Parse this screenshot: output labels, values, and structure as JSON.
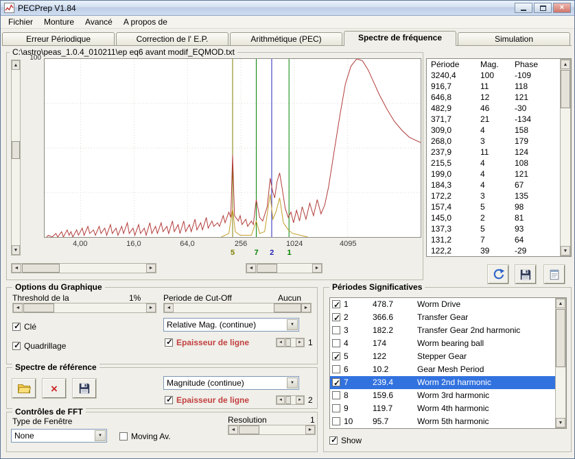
{
  "window": {
    "title": "PECPrep V1.84"
  },
  "menu": {
    "items": [
      "Fichier",
      "Monture",
      "Avancé",
      "A propos de"
    ]
  },
  "tabs": [
    {
      "label": "Erreur Périodique",
      "selected": false
    },
    {
      "label": "Correction de l' E.P.",
      "selected": false
    },
    {
      "label": "Arithmétique (PEC)",
      "selected": false
    },
    {
      "label": "Spectre de fréquence",
      "selected": true
    },
    {
      "label": "Simulation",
      "selected": false
    }
  ],
  "chart": {
    "group_title": "C:\\astro\\peas_1.0.4_010211\\ep eq6 avant modif_EQMOD.txt",
    "y_max_label": "100",
    "line_color": "#B03A37",
    "reference_color": "#C29B25",
    "grid_h": [
      0.25,
      0.5,
      0.75
    ],
    "x_ticks": [
      {
        "label": "4,00",
        "x": 0.096
      },
      {
        "label": "16,0",
        "x": 0.238
      },
      {
        "label": "64,0",
        "x": 0.38
      },
      {
        "label": "256",
        "x": 0.522
      },
      {
        "label": "1024",
        "x": 0.664
      },
      {
        "label": "4095",
        "x": 0.806
      }
    ],
    "markers": [
      {
        "label": "5",
        "x": 0.5,
        "color": "#7E7E00"
      },
      {
        "label": "7",
        "x": 0.563,
        "color": "#008000"
      },
      {
        "label": "2",
        "x": 0.604,
        "color": "#2222BB"
      },
      {
        "label": "1",
        "x": 0.65,
        "color": "#008000"
      }
    ],
    "spectrum_points": [
      [
        0.005,
        0
      ],
      [
        0.01,
        1
      ],
      [
        0.02,
        0
      ],
      [
        0.03,
        2
      ],
      [
        0.035,
        0
      ],
      [
        0.045,
        3
      ],
      [
        0.05,
        0
      ],
      [
        0.06,
        4
      ],
      [
        0.065,
        1
      ],
      [
        0.07,
        3
      ],
      [
        0.075,
        0
      ],
      [
        0.085,
        4
      ],
      [
        0.09,
        1
      ],
      [
        0.1,
        5
      ],
      [
        0.105,
        1
      ],
      [
        0.115,
        6
      ],
      [
        0.12,
        2
      ],
      [
        0.13,
        4
      ],
      [
        0.135,
        1
      ],
      [
        0.145,
        6
      ],
      [
        0.15,
        2
      ],
      [
        0.16,
        5
      ],
      [
        0.165,
        1
      ],
      [
        0.175,
        7
      ],
      [
        0.18,
        2
      ],
      [
        0.19,
        5
      ],
      [
        0.195,
        1
      ],
      [
        0.205,
        6
      ],
      [
        0.21,
        2
      ],
      [
        0.22,
        8
      ],
      [
        0.225,
        2
      ],
      [
        0.235,
        5
      ],
      [
        0.24,
        1
      ],
      [
        0.25,
        7
      ],
      [
        0.255,
        2
      ],
      [
        0.265,
        5
      ],
      [
        0.27,
        1
      ],
      [
        0.28,
        8
      ],
      [
        0.285,
        2
      ],
      [
        0.295,
        6
      ],
      [
        0.3,
        2
      ],
      [
        0.31,
        8
      ],
      [
        0.315,
        3
      ],
      [
        0.325,
        6
      ],
      [
        0.33,
        2
      ],
      [
        0.34,
        9
      ],
      [
        0.345,
        3
      ],
      [
        0.355,
        7
      ],
      [
        0.36,
        2
      ],
      [
        0.37,
        9
      ],
      [
        0.375,
        3
      ],
      [
        0.385,
        7
      ],
      [
        0.39,
        3
      ],
      [
        0.4,
        10
      ],
      [
        0.405,
        4
      ],
      [
        0.415,
        8
      ],
      [
        0.42,
        4
      ],
      [
        0.43,
        11
      ],
      [
        0.435,
        5
      ],
      [
        0.445,
        9
      ],
      [
        0.45,
        6
      ],
      [
        0.46,
        8
      ],
      [
        0.465,
        6
      ],
      [
        0.475,
        12
      ],
      [
        0.48,
        8
      ],
      [
        0.49,
        14
      ],
      [
        0.495,
        11
      ],
      [
        0.5,
        46
      ],
      [
        0.505,
        12
      ],
      [
        0.515,
        9
      ],
      [
        0.52,
        12
      ],
      [
        0.525,
        7
      ],
      [
        0.535,
        10
      ],
      [
        0.54,
        6
      ],
      [
        0.55,
        9
      ],
      [
        0.555,
        7
      ],
      [
        0.563,
        21
      ],
      [
        0.572,
        11
      ],
      [
        0.58,
        9
      ],
      [
        0.586,
        13
      ],
      [
        0.592,
        17
      ],
      [
        0.6,
        33
      ],
      [
        0.606,
        26
      ],
      [
        0.612,
        22
      ],
      [
        0.618,
        31
      ],
      [
        0.625,
        36
      ],
      [
        0.632,
        27
      ],
      [
        0.64,
        16
      ],
      [
        0.648,
        11
      ],
      [
        0.655,
        14
      ],
      [
        0.662,
        8
      ],
      [
        0.67,
        15
      ],
      [
        0.678,
        9
      ],
      [
        0.685,
        17
      ],
      [
        0.695,
        10
      ],
      [
        0.705,
        19
      ],
      [
        0.715,
        12
      ],
      [
        0.725,
        21
      ],
      [
        0.735,
        13
      ],
      [
        0.745,
        18
      ],
      [
        0.755,
        28
      ],
      [
        0.77,
        48
      ],
      [
        0.785,
        68
      ],
      [
        0.8,
        86
      ],
      [
        0.815,
        96
      ],
      [
        0.83,
        100
      ],
      [
        0.845,
        99
      ],
      [
        0.86,
        94
      ],
      [
        0.875,
        87
      ],
      [
        0.89,
        80
      ],
      [
        0.91,
        72
      ],
      [
        0.93,
        65
      ],
      [
        0.95,
        60
      ],
      [
        0.97,
        56
      ],
      [
        1,
        53
      ]
    ],
    "reference_points": [
      [
        0.47,
        0
      ],
      [
        0.49,
        2
      ],
      [
        0.5,
        16
      ],
      [
        0.507,
        3
      ],
      [
        0.52,
        1
      ],
      [
        0.55,
        1
      ],
      [
        0.563,
        9
      ],
      [
        0.572,
        2
      ],
      [
        0.585,
        3
      ],
      [
        0.6,
        24
      ],
      [
        0.607,
        10
      ],
      [
        0.615,
        14
      ],
      [
        0.625,
        22
      ],
      [
        0.635,
        8
      ],
      [
        0.648,
        4
      ],
      [
        0.66,
        2
      ],
      [
        0.68,
        1
      ],
      [
        0.7,
        0
      ]
    ]
  },
  "peak_table": {
    "headers": [
      "Période",
      "Mag.",
      "Phase"
    ],
    "rows": [
      [
        "3240,4",
        "100",
        "-109"
      ],
      [
        "916,7",
        "11",
        "118"
      ],
      [
        "646,8",
        "12",
        "121"
      ],
      [
        "482,9",
        "46",
        "-30"
      ],
      [
        "371,7",
        "21",
        "-134"
      ],
      [
        "309,0",
        "4",
        "158"
      ],
      [
        "268,0",
        "3",
        "179"
      ],
      [
        "237,9",
        "11",
        "124"
      ],
      [
        "215,5",
        "4",
        "108"
      ],
      [
        "199,0",
        "4",
        "121"
      ],
      [
        "184,3",
        "4",
        "67"
      ],
      [
        "172,2",
        "3",
        "135"
      ],
      [
        "157,4",
        "5",
        "98"
      ],
      [
        "145,0",
        "2",
        "81"
      ],
      [
        "137,3",
        "5",
        "93"
      ],
      [
        "131,2",
        "7",
        "64"
      ],
      [
        "122,2",
        "39",
        "-29"
      ]
    ]
  },
  "graph_options": {
    "title": "Options du Graphique",
    "threshold_label": "Threshold de la",
    "threshold_value": "1%",
    "cutoff_label": "Periode de Cut-Off",
    "cutoff_value": "Aucun",
    "cle_label": "Clé",
    "cle_checked": true,
    "quadrillage_label": "Quadrillage",
    "quadrillage_checked": true,
    "mag_mode": "Relative Mag. (continue)",
    "line_width_label": "Epaisseur de ligne",
    "line_width_checked": true,
    "line_width_value": "1"
  },
  "reference_panel": {
    "title": "Spectre de référence",
    "mode": "Magnitude (continue)",
    "line_width_label": "Epaisseur de ligne",
    "line_width_checked": true,
    "line_width_value": "2"
  },
  "fft": {
    "title": "Contrôles de FFT",
    "window_label": "Type de Fenêtre",
    "window_value": "None",
    "moving_av_label": "Moving Av.",
    "moving_av_checked": false,
    "resolution_label": "Resolution",
    "resolution_value": "1"
  },
  "periods": {
    "title": "Périodes Significatives",
    "show_label": "Show",
    "show_checked": true,
    "items": [
      {
        "num": "1",
        "value": "478.7",
        "name": "Worm Drive",
        "checked": true,
        "selected": false
      },
      {
        "num": "2",
        "value": "366.6",
        "name": "Transfer Gear",
        "checked": true,
        "selected": false
      },
      {
        "num": "3",
        "value": "182.2",
        "name": "Transfer Gear 2nd harmonic",
        "checked": false,
        "selected": false
      },
      {
        "num": "4",
        "value": "174",
        "name": "Worm bearing ball",
        "checked": false,
        "selected": false
      },
      {
        "num": "5",
        "value": "122",
        "name": "Stepper Gear",
        "checked": true,
        "selected": false
      },
      {
        "num": "6",
        "value": "10.2",
        "name": "Gear Mesh Period",
        "checked": false,
        "selected": false
      },
      {
        "num": "7",
        "value": "239.4",
        "name": "Worm 2nd harmonic",
        "checked": true,
        "selected": true
      },
      {
        "num": "8",
        "value": "159.6",
        "name": "Worm 3rd harmonic",
        "checked": false,
        "selected": false
      },
      {
        "num": "9",
        "value": "119.7",
        "name": "Worm 4th harmonic",
        "checked": false,
        "selected": false
      },
      {
        "num": "10",
        "value": "95.7",
        "name": "Worm 5th harmonic",
        "checked": false,
        "selected": false
      }
    ]
  }
}
